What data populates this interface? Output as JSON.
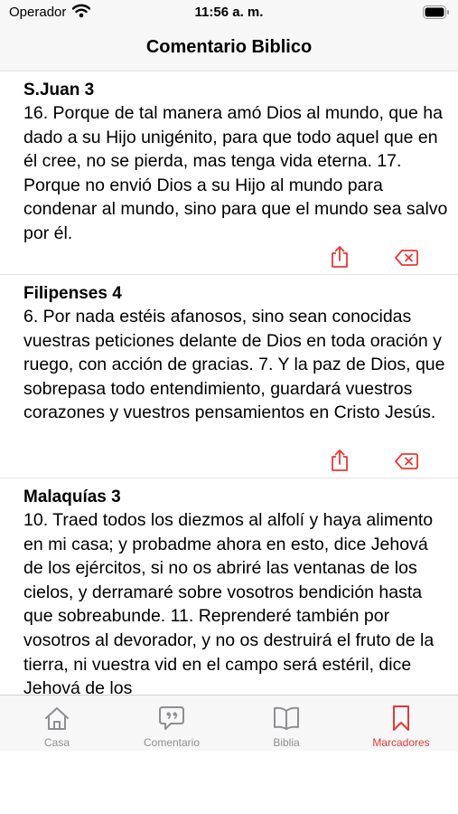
{
  "status_bar": {
    "carrier": "Operador",
    "time": "11:56 a. m."
  },
  "header": {
    "title": "Comentario Biblico"
  },
  "bookmarks": [
    {
      "reference": "S.Juan 3",
      "text": "16. Porque de tal manera amó Dios al mundo, que ha dado a su Hijo unigénito, para que todo aquel que en él cree, no se pierda, mas tenga vida eterna. 17. Porque no envió Dios a su Hijo al mundo para condenar al mundo, sino para que el mundo sea salvo por él."
    },
    {
      "reference": "Filipenses 4",
      "text": "6. Por nada estéis afanosos, sino sean conocidas vuestras peticiones delante de Dios en toda oración y ruego, con acción de gracias. 7. Y la paz de Dios, que sobrepasa todo entendimiento, guardará vuestros corazones y vuestros pensamientos en Cristo Jesús."
    },
    {
      "reference": "Malaquías 3",
      "text": "10. Traed todos los diezmos al alfolí y haya alimento en mi casa; y probadme ahora en esto, dice Jehová de los ejércitos, si no os abriré las ventanas de los cielos, y derramaré sobre vosotros bendición hasta que sobreabunde. 11. Reprenderé también por vosotros al devorador, y no os destruirá el fruto de la tierra, ni vuestra vid en el campo será estéril, dice Jehová de los"
    }
  ],
  "icons": {
    "share": "share-icon",
    "delete": "delete-icon"
  },
  "tab_bar": {
    "tabs": [
      {
        "label": "Casa",
        "icon": "house-icon",
        "active": false
      },
      {
        "label": "Comentario",
        "icon": "quote-bubble-icon",
        "active": false
      },
      {
        "label": "Biblia",
        "icon": "open-book-icon",
        "active": false
      },
      {
        "label": "Marcadores",
        "icon": "bookmark-icon",
        "active": true
      }
    ]
  },
  "colors": {
    "accent": "#e53935",
    "inactive_tab": "#8e8e93",
    "bar_background": "#f7f7f7"
  }
}
